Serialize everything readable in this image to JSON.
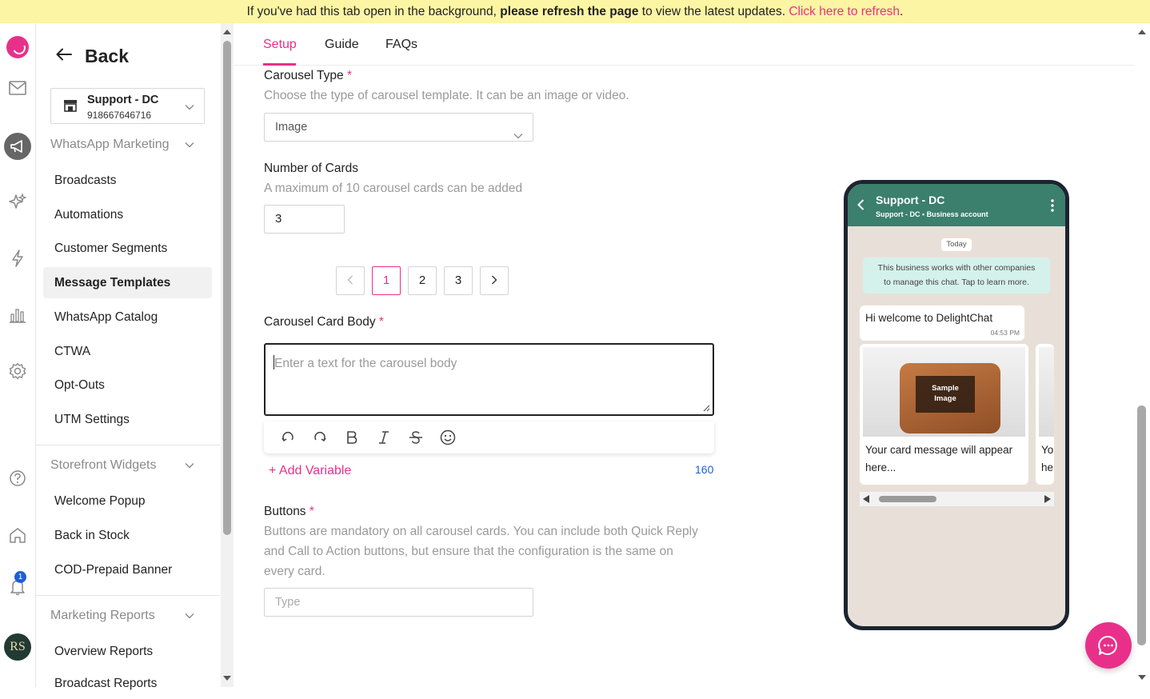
{
  "banner": {
    "prefix": "If you've had this tab open in the background,",
    "bold": "please refresh the page",
    "middle": "to view the latest updates.",
    "link": "Click here to refresh",
    "suffix": "."
  },
  "rail": {
    "icons": [
      "logo-icon",
      "mail-icon",
      "megaphone-icon",
      "sparkles-icon",
      "lightning-icon",
      "bar-chart-icon",
      "gear-icon",
      "help-icon",
      "home-icon",
      "bell-icon"
    ],
    "notification_count": "1",
    "avatar_text": "RS"
  },
  "sidebar": {
    "back_label": "Back",
    "account": {
      "name": "Support - DC",
      "number": "918667646716"
    },
    "sections": [
      {
        "title": "WhatsApp Marketing",
        "items": [
          "Broadcasts",
          "Automations",
          "Customer Segments",
          "Message Templates",
          "WhatsApp Catalog",
          "CTWA",
          "Opt-Outs",
          "UTM Settings"
        ],
        "active_index": 3
      },
      {
        "title": "Storefront Widgets",
        "items": [
          "Welcome Popup",
          "Back in Stock",
          "COD-Prepaid Banner"
        ]
      },
      {
        "title": "Marketing Reports",
        "items": [
          "Overview Reports",
          "Broadcast Reports"
        ]
      }
    ]
  },
  "tabs": [
    {
      "label": "Setup",
      "active": true
    },
    {
      "label": "Guide",
      "active": false
    },
    {
      "label": "FAQs",
      "active": false
    }
  ],
  "form": {
    "carousel_type": {
      "label": "Carousel Type",
      "required": "*",
      "help": "Choose the type of carousel template. It can be an image or video.",
      "value": "Image"
    },
    "number_of_cards": {
      "label": "Number of Cards",
      "help": "A maximum of 10 carousel cards can be added",
      "value": "3"
    },
    "pagination": {
      "prev": "<",
      "pages": [
        "1",
        "2",
        "3"
      ],
      "active_page": "1",
      "next": ">"
    },
    "card_body": {
      "label": "Carousel Card Body",
      "required": "*",
      "placeholder": "Enter a text for the carousel body",
      "add_variable": "+ Add Variable",
      "char_limit": "160"
    },
    "buttons": {
      "label": "Buttons",
      "required": "*",
      "help_lines": [
        "Buttons are mandatory on all carousel cards. You can include both Quick Reply",
        "and Call to Action buttons, but ensure that the configuration is the same on",
        "every card."
      ],
      "type_placeholder": "Type"
    }
  },
  "toolbar_icons": [
    "undo-icon",
    "redo-icon",
    "bold-icon",
    "italic-icon",
    "strikethrough-icon",
    "emoji-icon"
  ],
  "preview": {
    "contact_name": "Support - DC",
    "contact_sub": "Support - DC • Business account",
    "date_chip": "Today",
    "notice_lines": [
      "This business works with other companies",
      "to manage this chat. Tap to learn more."
    ],
    "message": "Hi welcome to DelightChat",
    "message_time": "04:53 PM",
    "sample_image_label_1": "Sample",
    "sample_image_label_2": "Image",
    "card_message_1": "Your card message will appear",
    "card_message_2": "here...",
    "card2_peek_1": "Yo",
    "card2_peek_2": "he"
  },
  "colors": {
    "accent": "#e8308a",
    "whatsapp_header": "#3b7f6d",
    "banner": "#fcf5a3",
    "link_blue": "#1e5fd6"
  }
}
